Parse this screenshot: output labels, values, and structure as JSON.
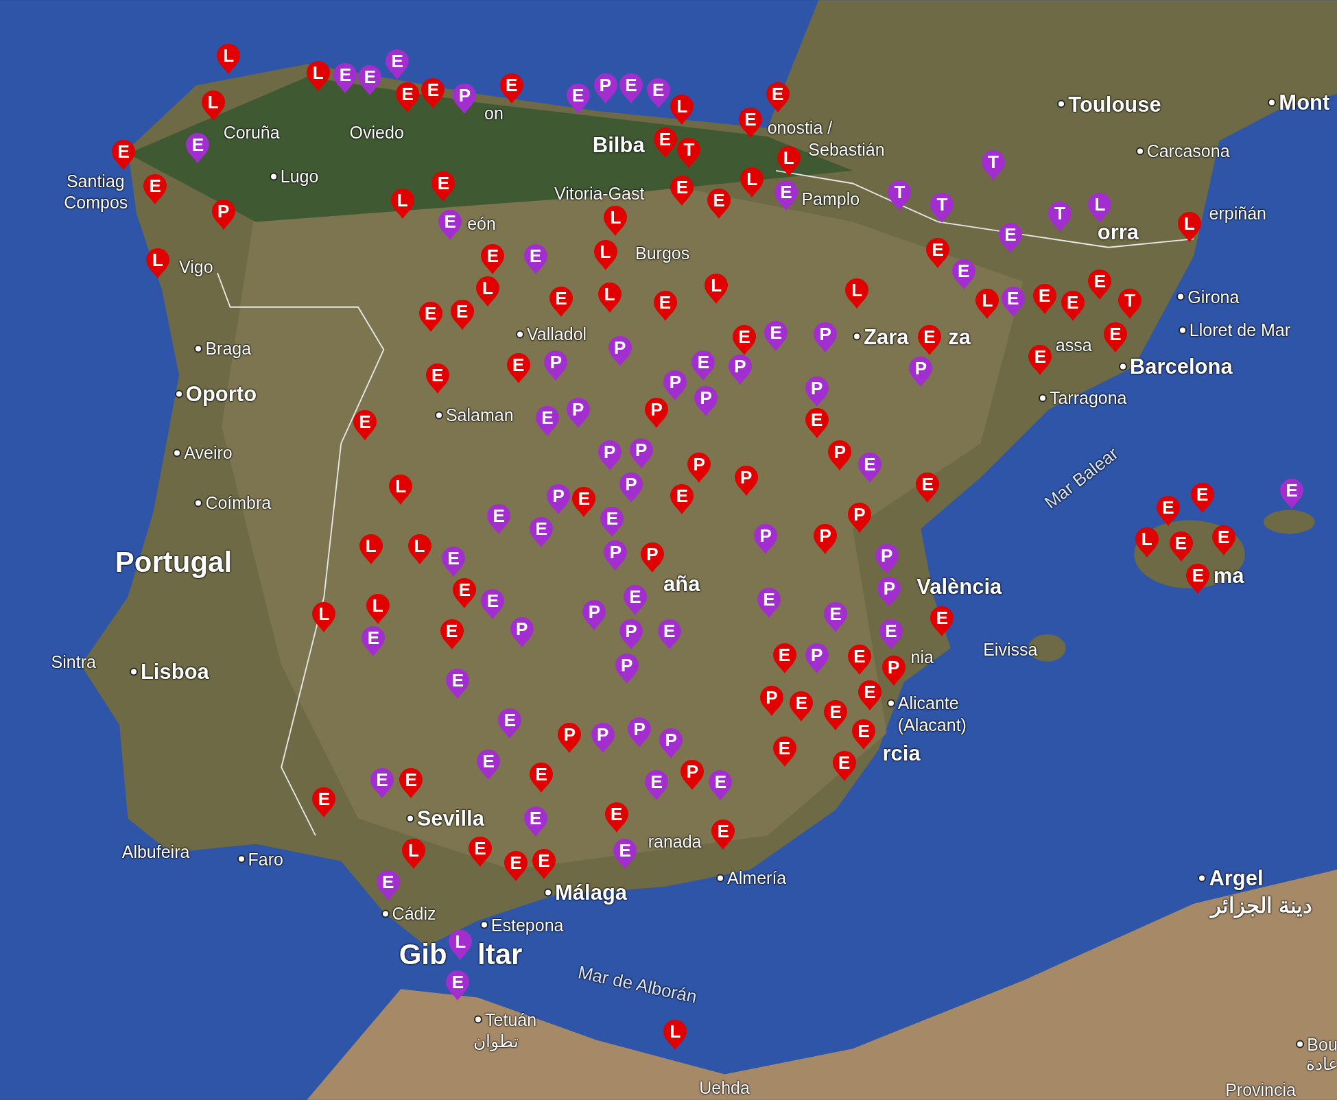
{
  "map": {
    "labels": [
      {
        "text": "Toulouse",
        "kind": "major"
      },
      {
        "text": "Mont",
        "kind": "major"
      },
      {
        "text": "Carcasona",
        "kind": "minor"
      },
      {
        "text": "erpiñán",
        "kind": "fragment"
      },
      {
        "text": "onostia /",
        "kind": "fragment"
      },
      {
        "text": "Sebastián",
        "kind": "fragment"
      },
      {
        "text": "Coruña",
        "kind": "fragment"
      },
      {
        "text": "Oviedo",
        "kind": "fragment"
      },
      {
        "text": "Lugo",
        "kind": "minor"
      },
      {
        "text": "Santiag",
        "kind": "fragment"
      },
      {
        "text": "Compos",
        "kind": "fragment"
      },
      {
        "text": "Vigo",
        "kind": "fragment"
      },
      {
        "text": "on",
        "kind": "fragment"
      },
      {
        "text": "Bilba",
        "kind": "fragment_major"
      },
      {
        "text": "Vitoria-Gast",
        "kind": "fragment"
      },
      {
        "text": "eón",
        "kind": "fragment"
      },
      {
        "text": "Pamplo",
        "kind": "fragment"
      },
      {
        "text": "Burgos",
        "kind": "fragment"
      },
      {
        "text": "orra",
        "kind": "fragment_major"
      },
      {
        "text": "Girona",
        "kind": "minor"
      },
      {
        "text": "Lloret de Mar",
        "kind": "minor"
      },
      {
        "text": "assa",
        "kind": "fragment"
      },
      {
        "text": "Barcelona",
        "kind": "major"
      },
      {
        "text": "Valladol",
        "kind": "minor"
      },
      {
        "text": "Zara",
        "kind": "major"
      },
      {
        "text": "za",
        "kind": "fragment_major"
      },
      {
        "text": "Tarragona",
        "kind": "minor"
      },
      {
        "text": "Salaman",
        "kind": "minor"
      },
      {
        "text": "Braga",
        "kind": "minor"
      },
      {
        "text": "Oporto",
        "kind": "major"
      },
      {
        "text": "Aveiro",
        "kind": "minor"
      },
      {
        "text": "Coímbra",
        "kind": "minor"
      },
      {
        "text": "Portugal",
        "kind": "country"
      },
      {
        "text": "aña",
        "kind": "fragment_major"
      },
      {
        "text": "València",
        "kind": "fragment_major"
      },
      {
        "text": "Sintra",
        "kind": "fragment"
      },
      {
        "text": "Lisboa",
        "kind": "major"
      },
      {
        "text": "nia",
        "kind": "fragment"
      },
      {
        "text": "Eivissa",
        "kind": "fragment"
      },
      {
        "text": "Alicante",
        "kind": "minor"
      },
      {
        "text": "(Alacant)",
        "kind": "fragment"
      },
      {
        "text": "rcia",
        "kind": "fragment_major"
      },
      {
        "text": "ma",
        "kind": "fragment_major"
      },
      {
        "text": "Sevilla",
        "kind": "major"
      },
      {
        "text": "Albufeira",
        "kind": "fragment"
      },
      {
        "text": "Faro",
        "kind": "minor"
      },
      {
        "text": "ranada",
        "kind": "fragment"
      },
      {
        "text": "Almería",
        "kind": "minor"
      },
      {
        "text": "Málaga",
        "kind": "major"
      },
      {
        "text": "Cádiz",
        "kind": "minor"
      },
      {
        "text": "Estepona",
        "kind": "minor"
      },
      {
        "text": "Gib",
        "kind": "fragment_big"
      },
      {
        "text": "ltar",
        "kind": "fragment_big"
      },
      {
        "text": "Mar de Alborán",
        "kind": "sea"
      },
      {
        "text": "Mar Balear",
        "kind": "sea"
      },
      {
        "text": "Tetuán",
        "kind": "minor"
      },
      {
        "text": "تطوان",
        "kind": "fragment"
      },
      {
        "text": "Argel",
        "kind": "major"
      },
      {
        "text": "دينة الجزائر",
        "kind": "fragment_major"
      },
      {
        "text": "Bou",
        "kind": "minor"
      },
      {
        "text": "عادة",
        "kind": "fragment"
      },
      {
        "text": "Provincia",
        "kind": "fragment"
      },
      {
        "text": "Uehda",
        "kind": "fragment"
      }
    ],
    "pins": [
      {
        "letter": "L",
        "color": "#e00000"
      },
      {
        "letter": "L",
        "color": "#e00000"
      },
      {
        "letter": "E",
        "color": "#a22ed0"
      },
      {
        "letter": "E",
        "color": "#e00000"
      },
      {
        "letter": "E",
        "color": "#e00000"
      },
      {
        "letter": "P",
        "color": "#e00000"
      },
      {
        "letter": "L",
        "color": "#e00000"
      },
      {
        "letter": "L",
        "color": "#e00000"
      },
      {
        "letter": "E",
        "color": "#a22ed0"
      },
      {
        "letter": "E",
        "color": "#a22ed0"
      },
      {
        "letter": "E",
        "color": "#a22ed0"
      },
      {
        "letter": "E",
        "color": "#e00000"
      },
      {
        "letter": "E",
        "color": "#e00000"
      },
      {
        "letter": "P",
        "color": "#a22ed0"
      },
      {
        "letter": "E",
        "color": "#e00000"
      },
      {
        "letter": "E",
        "color": "#a22ed0"
      },
      {
        "letter": "P",
        "color": "#a22ed0"
      },
      {
        "letter": "E",
        "color": "#a22ed0"
      },
      {
        "letter": "E",
        "color": "#a22ed0"
      },
      {
        "letter": "L",
        "color": "#e00000"
      },
      {
        "letter": "E",
        "color": "#e00000"
      },
      {
        "letter": "T",
        "color": "#e00000"
      },
      {
        "letter": "E",
        "color": "#e00000"
      },
      {
        "letter": "E",
        "color": "#e00000"
      },
      {
        "letter": "E",
        "color": "#e00000"
      },
      {
        "letter": "E",
        "color": "#e00000"
      },
      {
        "letter": "L",
        "color": "#e00000"
      },
      {
        "letter": "L",
        "color": "#e00000"
      },
      {
        "letter": "E",
        "color": "#a22ed0"
      },
      {
        "letter": "E",
        "color": "#e00000"
      },
      {
        "letter": "L",
        "color": "#e00000"
      },
      {
        "letter": "E",
        "color": "#a22ed0"
      },
      {
        "letter": "L",
        "color": "#e00000"
      },
      {
        "letter": "E",
        "color": "#e00000"
      },
      {
        "letter": "E",
        "color": "#a22ed0"
      },
      {
        "letter": "L",
        "color": "#e00000"
      },
      {
        "letter": "L",
        "color": "#e00000"
      },
      {
        "letter": "E",
        "color": "#e00000"
      },
      {
        "letter": "L",
        "color": "#e00000"
      },
      {
        "letter": "E",
        "color": "#e00000"
      },
      {
        "letter": "L",
        "color": "#e00000"
      },
      {
        "letter": "E",
        "color": "#e00000"
      },
      {
        "letter": "E",
        "color": "#e00000"
      },
      {
        "letter": "P",
        "color": "#a22ed0"
      },
      {
        "letter": "E",
        "color": "#e00000"
      },
      {
        "letter": "P",
        "color": "#a22ed0"
      },
      {
        "letter": "E",
        "color": "#e00000"
      },
      {
        "letter": "E",
        "color": "#e00000"
      },
      {
        "letter": "L",
        "color": "#e00000"
      },
      {
        "letter": "L",
        "color": "#e00000"
      },
      {
        "letter": "T",
        "color": "#a22ed0"
      },
      {
        "letter": "T",
        "color": "#a22ed0"
      },
      {
        "letter": "T",
        "color": "#a22ed0"
      },
      {
        "letter": "T",
        "color": "#a22ed0"
      },
      {
        "letter": "L",
        "color": "#a22ed0"
      },
      {
        "letter": "L",
        "color": "#e00000"
      },
      {
        "letter": "E",
        "color": "#a22ed0"
      },
      {
        "letter": "E",
        "color": "#e00000"
      },
      {
        "letter": "E",
        "color": "#a22ed0"
      },
      {
        "letter": "L",
        "color": "#e00000"
      },
      {
        "letter": "E",
        "color": "#a22ed0"
      },
      {
        "letter": "E",
        "color": "#e00000"
      },
      {
        "letter": "E",
        "color": "#e00000"
      },
      {
        "letter": "E",
        "color": "#e00000"
      },
      {
        "letter": "T",
        "color": "#e00000"
      },
      {
        "letter": "E",
        "color": "#e00000"
      },
      {
        "letter": "E",
        "color": "#e00000"
      },
      {
        "letter": "E",
        "color": "#e00000"
      },
      {
        "letter": "E",
        "color": "#a22ed0"
      },
      {
        "letter": "P",
        "color": "#a22ed0"
      },
      {
        "letter": "E",
        "color": "#e00000"
      },
      {
        "letter": "E",
        "color": "#a22ed0"
      },
      {
        "letter": "P",
        "color": "#a22ed0"
      },
      {
        "letter": "P",
        "color": "#a22ed0"
      },
      {
        "letter": "P",
        "color": "#a22ed0"
      },
      {
        "letter": "P",
        "color": "#a22ed0"
      },
      {
        "letter": "P",
        "color": "#a22ed0"
      },
      {
        "letter": "E",
        "color": "#e00000"
      },
      {
        "letter": "P",
        "color": "#e00000"
      },
      {
        "letter": "E",
        "color": "#a22ed0"
      },
      {
        "letter": "P",
        "color": "#a22ed0"
      },
      {
        "letter": "P",
        "color": "#e00000"
      },
      {
        "letter": "P",
        "color": "#a22ed0"
      },
      {
        "letter": "P",
        "color": "#a22ed0"
      },
      {
        "letter": "P",
        "color": "#a22ed0"
      },
      {
        "letter": "E",
        "color": "#e00000"
      },
      {
        "letter": "P",
        "color": "#e00000"
      },
      {
        "letter": "P",
        "color": "#e00000"
      },
      {
        "letter": "E",
        "color": "#a22ed0"
      },
      {
        "letter": "E",
        "color": "#e00000"
      },
      {
        "letter": "P",
        "color": "#e00000"
      },
      {
        "letter": "P",
        "color": "#a22ed0"
      },
      {
        "letter": "P",
        "color": "#e00000"
      },
      {
        "letter": "E",
        "color": "#a22ed0"
      },
      {
        "letter": "E",
        "color": "#a22ed0"
      },
      {
        "letter": "P",
        "color": "#a22ed0"
      },
      {
        "letter": "E",
        "color": "#e00000"
      },
      {
        "letter": "P",
        "color": "#a22ed0"
      },
      {
        "letter": "P",
        "color": "#e00000"
      },
      {
        "letter": "E",
        "color": "#a22ed0"
      },
      {
        "letter": "L",
        "color": "#e00000"
      },
      {
        "letter": "L",
        "color": "#e00000"
      },
      {
        "letter": "E",
        "color": "#a22ed0"
      },
      {
        "letter": "E",
        "color": "#e00000"
      },
      {
        "letter": "E",
        "color": "#a22ed0"
      },
      {
        "letter": "P",
        "color": "#a22ed0"
      },
      {
        "letter": "L",
        "color": "#e00000"
      },
      {
        "letter": "L",
        "color": "#e00000"
      },
      {
        "letter": "E",
        "color": "#a22ed0"
      },
      {
        "letter": "E",
        "color": "#e00000"
      },
      {
        "letter": "E",
        "color": "#a22ed0"
      },
      {
        "letter": "P",
        "color": "#a22ed0"
      },
      {
        "letter": "E",
        "color": "#a22ed0"
      },
      {
        "letter": "P",
        "color": "#a22ed0"
      },
      {
        "letter": "E",
        "color": "#a22ed0"
      },
      {
        "letter": "P",
        "color": "#a22ed0"
      },
      {
        "letter": "E",
        "color": "#a22ed0"
      },
      {
        "letter": "E",
        "color": "#a22ed0"
      },
      {
        "letter": "P",
        "color": "#a22ed0"
      },
      {
        "letter": "P",
        "color": "#a22ed0"
      },
      {
        "letter": "E",
        "color": "#a22ed0"
      },
      {
        "letter": "E",
        "color": "#e00000"
      },
      {
        "letter": "E",
        "color": "#e00000"
      },
      {
        "letter": "P",
        "color": "#a22ed0"
      },
      {
        "letter": "E",
        "color": "#e00000"
      },
      {
        "letter": "P",
        "color": "#e00000"
      },
      {
        "letter": "P",
        "color": "#e00000"
      },
      {
        "letter": "E",
        "color": "#e00000"
      },
      {
        "letter": "E",
        "color": "#e00000"
      },
      {
        "letter": "E",
        "color": "#e00000"
      },
      {
        "letter": "E",
        "color": "#e00000"
      },
      {
        "letter": "E",
        "color": "#e00000"
      },
      {
        "letter": "E",
        "color": "#e00000"
      },
      {
        "letter": "E",
        "color": "#a22ed0"
      },
      {
        "letter": "P",
        "color": "#e00000"
      },
      {
        "letter": "P",
        "color": "#a22ed0"
      },
      {
        "letter": "P",
        "color": "#a22ed0"
      },
      {
        "letter": "P",
        "color": "#a22ed0"
      },
      {
        "letter": "E",
        "color": "#a22ed0"
      },
      {
        "letter": "E",
        "color": "#e00000"
      },
      {
        "letter": "E",
        "color": "#a22ed0"
      },
      {
        "letter": "P",
        "color": "#e00000"
      },
      {
        "letter": "E",
        "color": "#a22ed0"
      },
      {
        "letter": "E",
        "color": "#e00000"
      },
      {
        "letter": "E",
        "color": "#a22ed0"
      },
      {
        "letter": "E",
        "color": "#e00000"
      },
      {
        "letter": "E",
        "color": "#a22ed0"
      },
      {
        "letter": "E",
        "color": "#e00000"
      },
      {
        "letter": "E",
        "color": "#a22ed0"
      },
      {
        "letter": "E",
        "color": "#e00000"
      },
      {
        "letter": "E",
        "color": "#e00000"
      },
      {
        "letter": "E",
        "color": "#e00000"
      },
      {
        "letter": "E",
        "color": "#e00000"
      },
      {
        "letter": "L",
        "color": "#e00000"
      },
      {
        "letter": "E",
        "color": "#a22ed0"
      },
      {
        "letter": "L",
        "color": "#a22ed0"
      },
      {
        "letter": "E",
        "color": "#a22ed0"
      },
      {
        "letter": "L",
        "color": "#e00000"
      },
      {
        "letter": "E",
        "color": "#e00000"
      },
      {
        "letter": "E",
        "color": "#e00000"
      },
      {
        "letter": "L",
        "color": "#e00000"
      },
      {
        "letter": "E",
        "color": "#e00000"
      },
      {
        "letter": "E",
        "color": "#e00000"
      },
      {
        "letter": "E",
        "color": "#e00000"
      },
      {
        "letter": "E",
        "color": "#a22ed0"
      }
    ]
  }
}
